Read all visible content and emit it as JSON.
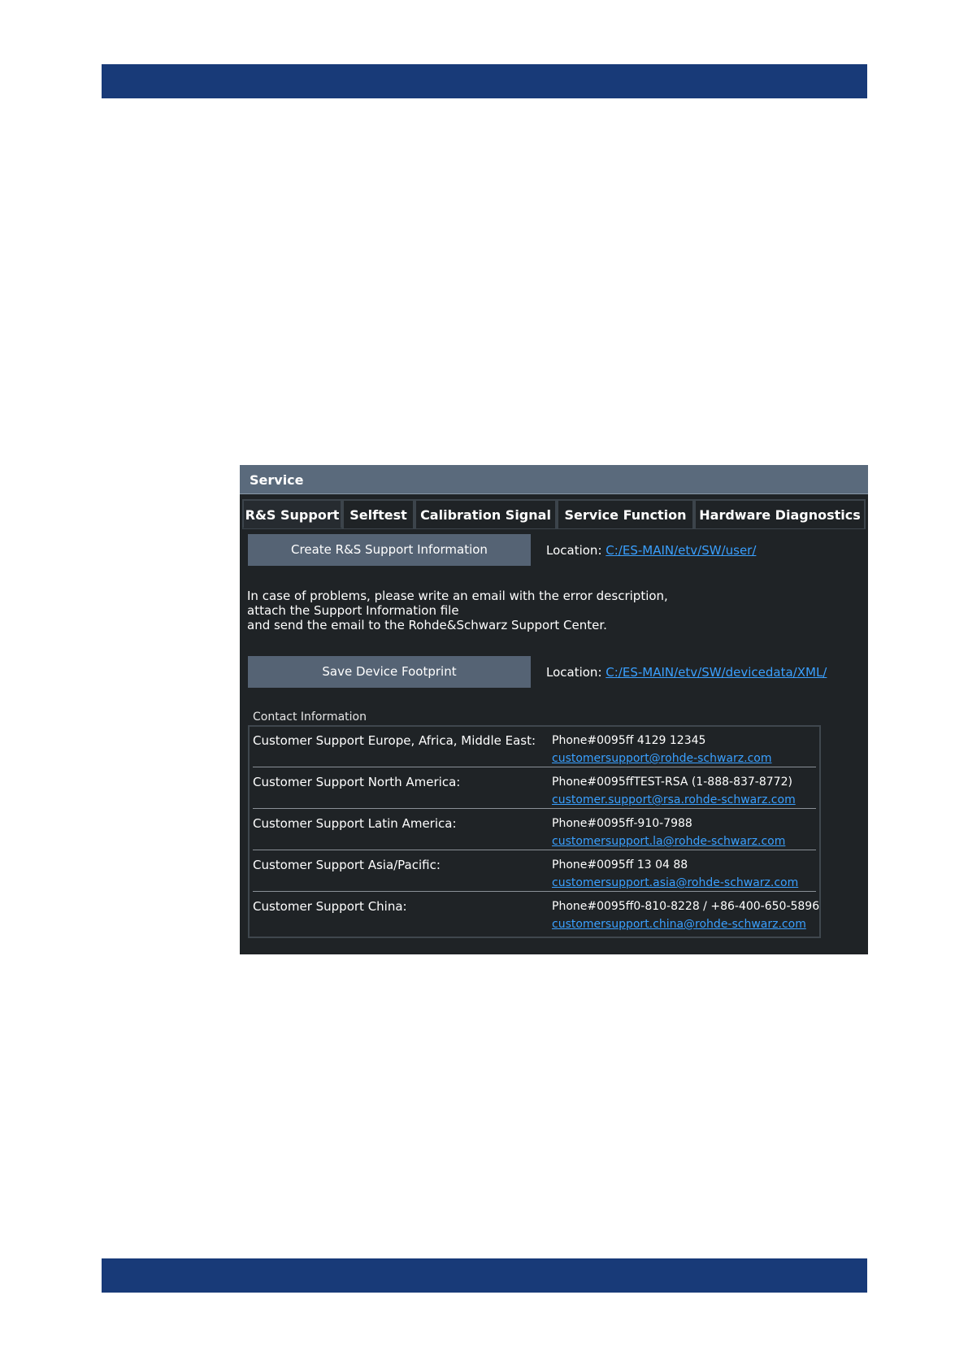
{
  "dialog": {
    "title": "Service",
    "tabs": [
      {
        "label": "R&S Support",
        "active": true
      },
      {
        "label": "Selftest",
        "active": false
      },
      {
        "label": "Calibration Signal",
        "active": false
      },
      {
        "label": "Service Function",
        "active": false
      },
      {
        "label": "Hardware Diagnostics",
        "active": false
      }
    ],
    "create_button_label": "Create R&S Support Information",
    "location_label": "Location:",
    "support_info_location": "C:/ES-MAIN/etv/SW/user/",
    "problem_text": [
      "In case of problems, please write an email with the error description,",
      "attach the Support Information file",
      "and send the email to the Rohde&Schwarz Support Center."
    ],
    "save_button_label": "Save Device Footprint",
    "footprint_location": "C:/ES-MAIN/etv/SW/devicedata/XML/",
    "contact_heading": "Contact Information",
    "contacts": [
      {
        "name": "Customer Support Europe, Africa, Middle East:",
        "phone": "Phone#0095ff 4129 12345",
        "email": "customersupport@rohde-schwarz.com"
      },
      {
        "name": "Customer Support North America:",
        "phone": "Phone#0095ffTEST-RSA (1-888-837-8772)",
        "email": "customer.support@rsa.rohde-schwarz.com"
      },
      {
        "name": "Customer Support Latin America:",
        "phone": "Phone#0095ff-910-7988",
        "email": "customersupport.la@rohde-schwarz.com"
      },
      {
        "name": "Customer Support Asia/Pacific:",
        "phone": "Phone#0095ff 13 04 88",
        "email": "customersupport.asia@rohde-schwarz.com"
      },
      {
        "name": "Customer Support China:",
        "phone": "Phone#0095ff0-810-8228 / +86-400-650-5896",
        "email": "customersupport.china@rohde-schwarz.com"
      }
    ]
  },
  "colors": {
    "page_band": "#183a78",
    "dialog_background": "#1f2326",
    "titlebar": "#5a6a7c",
    "button": "#556374",
    "link": "#3aa0ff"
  }
}
